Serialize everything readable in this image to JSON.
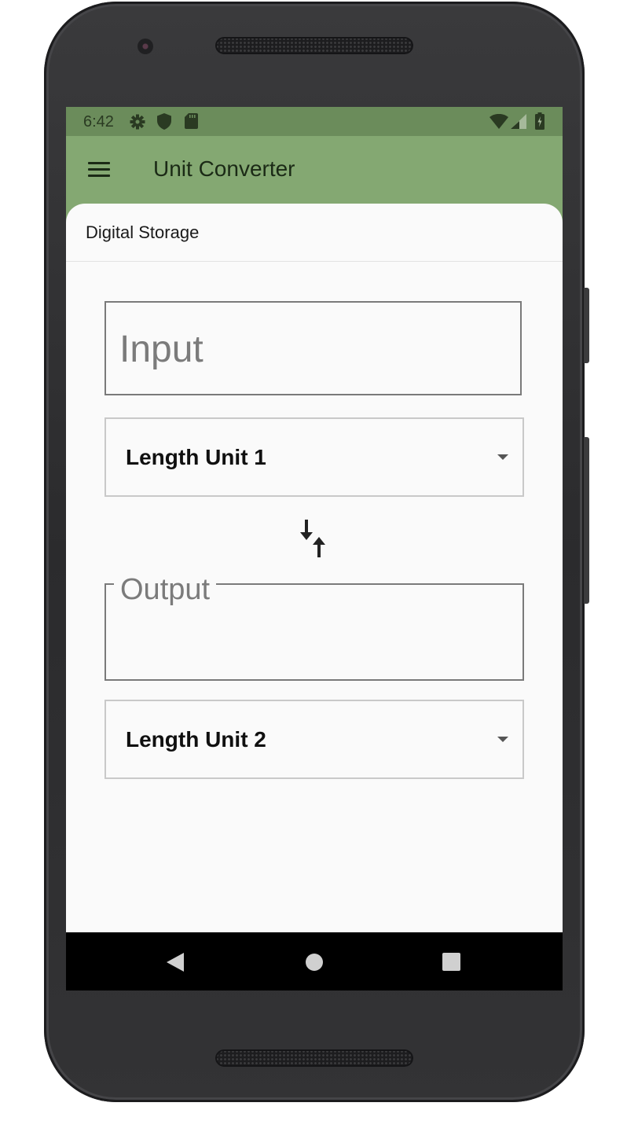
{
  "status_bar": {
    "time": "6:42",
    "icons": [
      "settings-icon",
      "shield-icon",
      "sd-card-icon",
      "wifi-icon",
      "signal-icon",
      "battery-icon"
    ]
  },
  "app_bar": {
    "title": "Unit Converter",
    "menu_icon": "hamburger-menu-icon",
    "background_color": "#84a872"
  },
  "category": {
    "title": "Digital Storage"
  },
  "converter": {
    "input_placeholder": "Input",
    "from_unit": "Length Unit 1",
    "swap_icon": "swap-vertical-icon",
    "output_label": "Output",
    "output_value": "",
    "to_unit": "Length Unit 2"
  },
  "nav_bar": {
    "back_icon": "back-triangle-icon",
    "home_icon": "home-circle-icon",
    "recents_icon": "recents-square-icon"
  }
}
